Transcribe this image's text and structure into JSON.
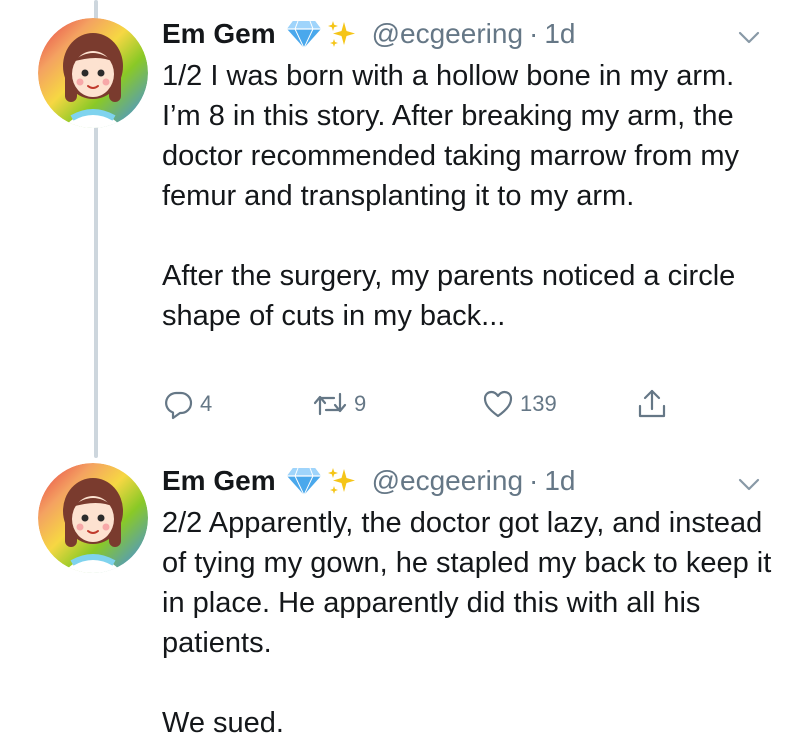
{
  "tweets": [
    {
      "author": {
        "display_name": "Em Gem",
        "handle": "@ecgeering",
        "separator": "·",
        "time": "1d"
      },
      "text": [
        "1/2 I was born with a hollow bone in my arm. I’m 8 in this story. After breaking my arm, the doctor recommended taking marrow from my femur and transplanting it to my arm.",
        "After the surgery, my parents noticed a circle shape of cuts in my back..."
      ],
      "actions": {
        "replies": "4",
        "retweets": "9",
        "likes": "139"
      }
    },
    {
      "author": {
        "display_name": "Em Gem",
        "handle": "@ecgeering",
        "separator": "·",
        "time": "1d"
      },
      "text": [
        "2/2 Apparently, the doctor got lazy, and instead of tying my gown, he stapled my back to keep it in place. He apparently did this with all his patients.",
        "We sued."
      ]
    }
  ],
  "icons": {
    "badges": [
      "blue-diamond-icon",
      "sparkles-icon"
    ],
    "caret": "chevron-down-icon",
    "actions": [
      "reply-icon",
      "retweet-icon",
      "like-icon",
      "share-icon"
    ]
  },
  "colors": {
    "text": "#14171a",
    "secondary": "#657786",
    "thread_line": "#cdd6dd",
    "diamond": "#4aa8ec",
    "sparkles": "#f5c518"
  }
}
